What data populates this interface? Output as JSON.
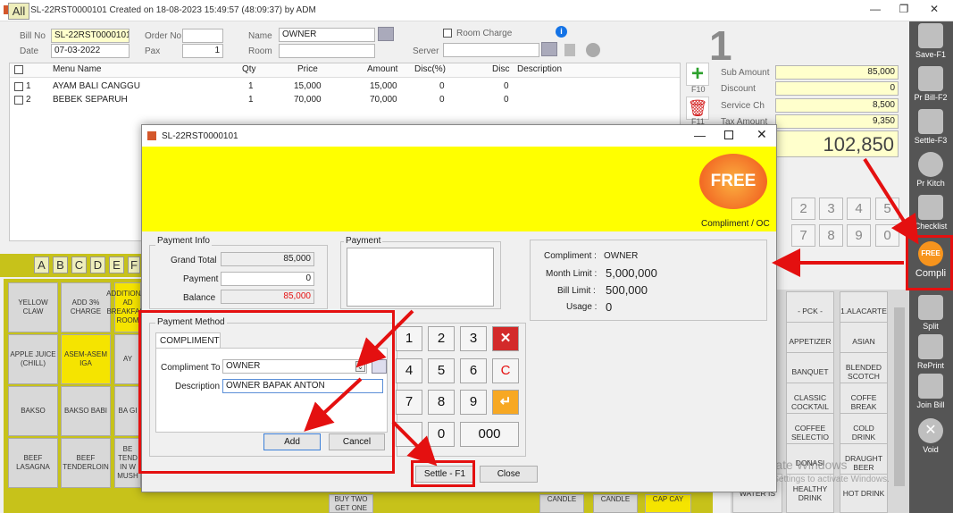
{
  "window": {
    "title": "Bill SL-22RST0000101 Created on 18-08-2023 15:49:57 (48:09:37) by ADM",
    "min": "—",
    "max": "❐",
    "close": "✕"
  },
  "header": {
    "bill_no_label": "Bill No",
    "bill_no": "SL-22RST0000101",
    "order_no_label": "Order No",
    "order_no": "",
    "date_label": "Date",
    "date": "07-03-2022",
    "pax_label": "Pax",
    "pax": "1",
    "name_label": "Name",
    "name": "OWNER",
    "room_label": "Room",
    "room": "",
    "room_charge_label": "Room Charge",
    "server_label": "Server",
    "server": "",
    "table_number": "1"
  },
  "grid": {
    "columns": [
      "Menu Name",
      "Qty",
      "Price",
      "Amount",
      "Disc(%)",
      "Disc",
      "Description"
    ],
    "rows": [
      {
        "no": "1",
        "name": "AYAM BALI CANGGU",
        "qty": "1",
        "price": "15,000",
        "amount": "15,000",
        "discp": "0",
        "disc": "0",
        "desc": ""
      },
      {
        "no": "2",
        "name": "BEBEK SEPARUH",
        "qty": "1",
        "price": "70,000",
        "amount": "70,000",
        "discp": "0",
        "disc": "0",
        "desc": ""
      }
    ]
  },
  "summary": {
    "sub_amount_label": "Sub Amount",
    "sub_amount": "85,000",
    "discount_label": "Discount",
    "discount": "0",
    "service_label": "Service Ch",
    "service": "8,500",
    "tax_label": "Tax Amount",
    "tax": "9,350",
    "total": "102,850",
    "f10": "F10",
    "f11": "F11"
  },
  "right_toolbar": [
    {
      "label": "Save-F1",
      "icon": "save-icon"
    },
    {
      "label": "Pr Bill-F2",
      "icon": "printer-icon"
    },
    {
      "label": "Settle-F3",
      "icon": "cash-register-icon"
    },
    {
      "label": "Pr Kitch",
      "icon": "kitchen-icon"
    },
    {
      "label": "Checklist",
      "icon": "checklist-icon"
    },
    {
      "label": "Compli",
      "icon": "free-badge-icon"
    },
    {
      "label": "Split",
      "icon": "split-icon"
    },
    {
      "label": "RePrint",
      "icon": "reprint-icon"
    },
    {
      "label": "Join Bill",
      "icon": "join-icon"
    },
    {
      "label": "Void",
      "icon": "void-icon"
    }
  ],
  "keypad_bg": [
    "2",
    "3",
    "4",
    "5",
    "7",
    "8",
    "9",
    "0"
  ],
  "categories": [
    "All",
    "A",
    "B",
    "C",
    "D",
    "E",
    "F"
  ],
  "menu_left": [
    "YELLOW CLAW",
    "ADD 3% CHARGE",
    "ADDITIONAL AD BREAKFAST ROOM",
    "APPLE JUICE (CHILL)",
    "ASEM-ASEM IGA",
    "AY",
    "BAKSO",
    "BAKSO BABI",
    "BA GI",
    "BEEF LASAGNA",
    "BEEF TENDERLOIN",
    "BE TEND IN W MUSH"
  ],
  "menu_bottom": [
    "BUY TWO GET ONE",
    "CANDLE",
    "CANDLE",
    "CAP CAY"
  ],
  "menu_right": [
    "- PCK -",
    "1.ALACARTE",
    "APPETIZER",
    "ASIAN",
    "BANQUET",
    "BLENDED SCOTCH",
    "CLASSIC COCKTAIL",
    "COFFE BREAK",
    "COFFEE SELECTIO",
    "COLD DRINK",
    "DONASI",
    "DRAUGHT BEER",
    "WATER IS",
    "HEALTHY DRINK",
    "HOT DRINK"
  ],
  "watermark": {
    "line1": "Activate Windows",
    "line2": "Go to Settings to activate Windows."
  },
  "dialog": {
    "title": "SL-22RST0000101",
    "badge": "FREE",
    "badge_caption": "Compliment / OC",
    "payment_info_label": "Payment Info",
    "grand_total_label": "Grand Total",
    "grand_total": "85,000",
    "payment_label": "Payment",
    "payment": "0",
    "balance_label": "Balance",
    "balance": "85,000",
    "payment_list_label": "Payment",
    "compliment_label": "Compliment :",
    "compliment_value": "OWNER",
    "month_limit_label": "Month Limit :",
    "month_limit": "5,000,000",
    "bill_limit_label": "Bill Limit :",
    "bill_limit": "500,000",
    "usage_label": "Usage :",
    "usage": "0",
    "payment_method_label": "Payment Method",
    "tab": "COMPLIMENT",
    "compliment_to_label": "Compliment To",
    "compliment_to": "OWNER",
    "description_label": "Description",
    "description": "OWNER BAPAK ANTON",
    "add": "Add",
    "cancel": "Cancel",
    "keys": [
      "1",
      "2",
      "3",
      "4",
      "5",
      "6",
      "7",
      "8",
      "9",
      ".",
      "0",
      "000"
    ],
    "clear_key": "C",
    "settle": "Settle - F1",
    "close_btn": "Close"
  },
  "colors": {
    "accent_red": "#e41010",
    "yellow": "#ffff00",
    "olive": "#c7c21a"
  }
}
